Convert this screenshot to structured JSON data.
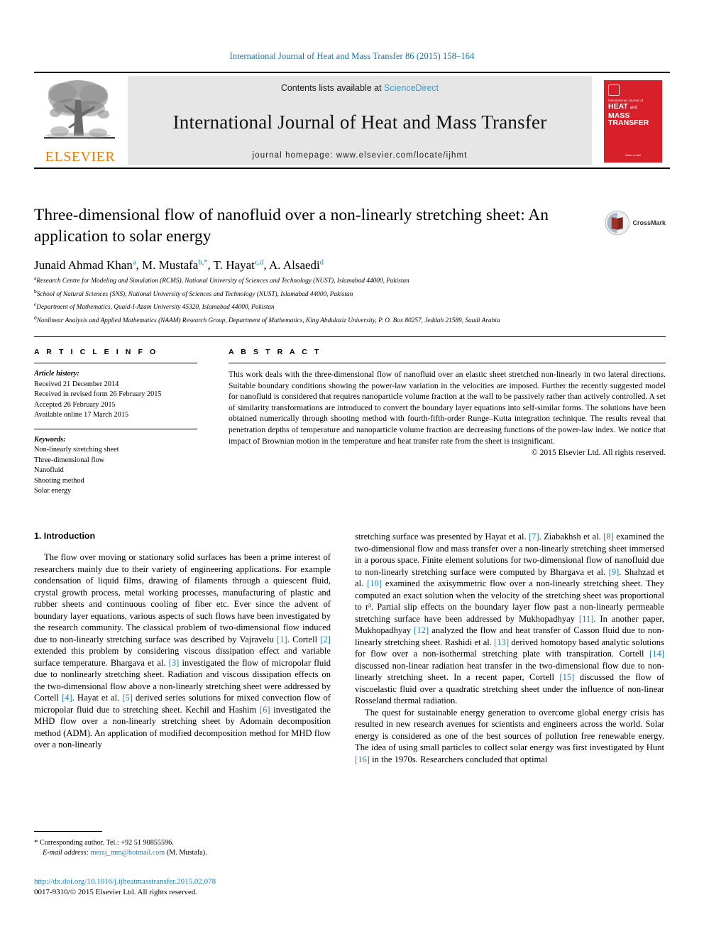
{
  "running_head": "International Journal of Heat and Mass Transfer 86 (2015) 158–164",
  "masthead": {
    "publisher": "ELSEVIER",
    "contents_prefix": "Contents lists available at ",
    "sciencedirect": "ScienceDirect",
    "journal_title": "International Journal of Heat and Mass Transfer",
    "homepage": "journal homepage: www.elsevier.com/locate/ijhmt",
    "cover": {
      "line_small": "International Journal of",
      "line_main_1": "HEAT",
      "line_main_and": "and",
      "line_main_2": "MASS",
      "line_main_3": "TRANSFER",
      "footer": "Editors-in-Chief"
    }
  },
  "article": {
    "title": "Three-dimensional flow of nanofluid over a non-linearly stretching sheet: An application to solar energy",
    "authors": [
      {
        "name": "Junaid Ahmad Khan",
        "marks": "a"
      },
      {
        "name": "M. Mustafa",
        "marks": "b,*"
      },
      {
        "name": "T. Hayat",
        "marks": "c,d"
      },
      {
        "name": "A. Alsaedi",
        "marks": "d"
      }
    ],
    "affiliations": [
      {
        "mark": "a",
        "text": "Research Centre for Modeling and Simulation (RCMS), National University of Sciences and Technology (NUST), Islamabad 44000, Pakistan"
      },
      {
        "mark": "b",
        "text": "School of Natural Sciences (SNS), National University of Sciences and Technology (NUST), Islamabad 44000, Pakistan"
      },
      {
        "mark": "c",
        "text": "Department of Mathematics, Quaid-I-Azam University 45320, Islamabad 44000, Pakistan"
      },
      {
        "mark": "d",
        "text": "Nonlinear Analysis and Applied Mathematics (NAAM) Research Group, Department of Mathematics, King Abdulaziz University, P. O. Box 80257, Jeddah 21589, Saudi Arabia"
      }
    ],
    "crossmark_label": "CrossMark"
  },
  "info": {
    "heading": "A R T I C L E   I N F O",
    "history_label": "Article history:",
    "history": [
      "Received 21 December 2014",
      "Received in revised form 26 February 2015",
      "Accepted 26 February 2015",
      "Available online 17 March 2015"
    ],
    "keywords_label": "Keywords:",
    "keywords": [
      "Non-linearly stretching sheet",
      "Three-dimensional flow",
      "Nanofluid",
      "Shooting method",
      "Solar energy"
    ]
  },
  "abstract": {
    "heading": "A B S T R A C T",
    "text": "This work deals with the three-dimensional flow of nanofluid over an elastic sheet stretched non-linearly in two lateral directions. Suitable boundary conditions showing the power-law variation in the velocities are imposed. Further the recently suggested model for nanofluid is considered that requires nanoparticle volume fraction at the wall to be passively rather than actively controlled. A set of similarity transformations are introduced to convert the boundary layer equations into self-similar forms. The solutions have been obtained numerically through shooting method with fourth-fifth-order Runge–Kutta integration technique. The results reveal that penetration depths of temperature and nanoparticle volume fraction are decreasing functions of the power-law index. We notice that impact of Brownian motion in the temperature and heat transfer rate from the sheet is insignificant.",
    "copyright": "© 2015 Elsevier Ltd. All rights reserved."
  },
  "introduction": {
    "heading": "1. Introduction",
    "left_paragraph_1": "The flow over moving or stationary solid surfaces has been a prime interest of researchers mainly due to their variety of engineering applications. For example condensation of liquid films, drawing of filaments through a quiescent fluid, crystal growth process, metal working processes, manufacturing of plastic and rubber sheets and continuous cooling of fiber etc. Ever since the advent of boundary layer equations, various aspects of such flows have been investigated by the research community. The classical problem of two-dimensional flow induced due to non-linearly stretching surface was described by Vajravelu [1]. Cortell [2] extended this problem by considering viscous dissipation effect and variable surface temperature. Bhargava et al. [3] investigated the flow of micropolar fluid due to nonlinearly stretching sheet. Radiation and viscous dissipation effects on the two-dimensional flow above a non-linearly stretching sheet were addressed by Cortell [4]. Hayat et al. [5] derived series solutions for mixed convection flow of micropolar fluid due to stretching sheet. Kechil and Hashim [6] investigated the MHD flow over a non-linearly stretching sheet by Adomain decomposition method (ADM). An application of modified decomposition method for MHD flow over a non-linearly",
    "right_paragraph_1": "stretching surface was presented by Hayat et al. [7]. Ziabakhsh et al. [8] examined the two-dimensional flow and mass transfer over a non-linearly stretching sheet immersed in a porous space. Finite element solutions for two-dimensional flow of nanofluid due to non-linearly stretching surface were computed by Bhargava et al. [9]. Shahzad et al. [10] examined the axisymmetric flow over a non-linearly stretching sheet. They computed an exact solution when the velocity of the stretching sheet was proportional to r³. Partial slip effects on the boundary layer flow past a non-linearly permeable stretching surface have been addressed by Mukhopadhyay [11]. In another paper, Mukhopadhyay [12] analyzed the flow and heat transfer of Casson fluid due to non-linearly stretching sheet. Rashidi et al. [13] derived homotopy based analytic solutions for flow over a non-isothermal stretching plate with transpiration. Cortell [14] discussed non-linear radiation heat transfer in the two-dimensional flow due to non-linearly stretching sheet. In a recent paper, Cortell [15] discussed the flow of viscoelastic fluid over a quadratic stretching sheet under the influence of non-linear Rosseland thermal radiation.",
    "right_paragraph_2": "The quest for sustainable energy generation to overcome global energy crisis has resulted in new research avenues for scientists and engineers across the world. Solar energy is considered as one of the best sources of pollution free renewable energy. The idea of using small particles to collect solar energy was first investigated by Hunt [16] in the 1970s. Researchers concluded that optimal"
  },
  "footer": {
    "corresponding_star": "*",
    "corresponding_text": "Corresponding author. Tel.: +92 51 90855596.",
    "email_label": "E-mail address:",
    "email": "meraj_mm@hotmail.com",
    "email_owner": "(M. Mustafa).",
    "doi": "http://dx.doi.org/10.1016/j.ijheatmasstransfer.2015.02.078",
    "issn_line": "0017-9310/© 2015 Elsevier Ltd. All rights reserved."
  },
  "colors": {
    "link_blue": "#1b7fb5",
    "sd_blue": "#2e9fd4",
    "elsevier_orange": "#ef7d00",
    "cover_red": "#d8202a"
  }
}
